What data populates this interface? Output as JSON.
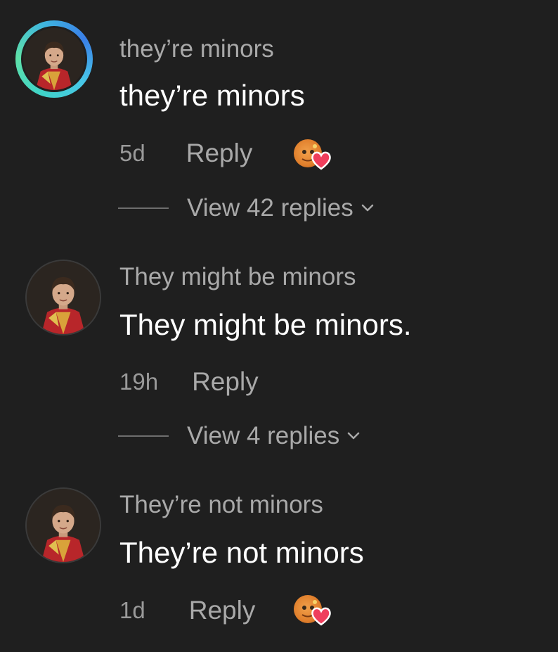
{
  "comments": [
    {
      "username": "they’re minors",
      "text": "they’re minors",
      "time": "5d",
      "reply_label": "Reply",
      "has_story_ring": true,
      "liked_by_author": true,
      "view_replies_label": "View 42 replies"
    },
    {
      "username": "They might be minors",
      "text": "They might be minors.",
      "time": "19h",
      "reply_label": "Reply",
      "has_story_ring": false,
      "liked_by_author": false,
      "view_replies_label": "View 4 replies"
    },
    {
      "username": "They’re not minors",
      "text": "They’re not minors",
      "time": "1d",
      "reply_label": "Reply",
      "has_story_ring": false,
      "liked_by_author": true,
      "view_replies_label": ""
    }
  ],
  "icons": {
    "avatar": "profile-photo",
    "liked_avatar": "author-mini-avatar",
    "heart": "heart-icon",
    "chevron": "chevron-down-icon"
  },
  "colors": {
    "background": "#1f1f1f",
    "username": "#a9a9a9",
    "text": "#ffffff",
    "heart": "#ef3e5c",
    "story_ring_start": "#3fd3c8",
    "story_ring_end": "#3a7fe8"
  }
}
